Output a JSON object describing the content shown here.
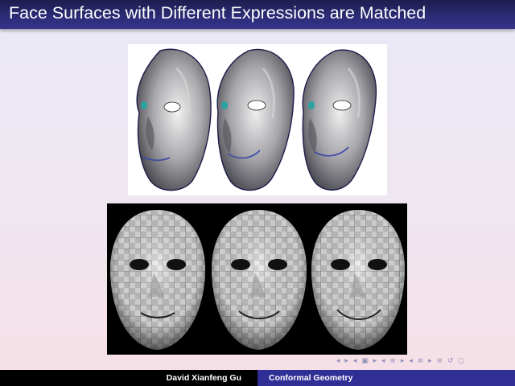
{
  "slide": {
    "title": "Face Surfaces with Different Expressions are Matched"
  },
  "figures": {
    "top_panel": {
      "faces": [
        "face-neutral",
        "face-smile",
        "face-smile-wide"
      ],
      "background": "#ffffff"
    },
    "bottom_panel": {
      "faces": [
        "face-mesh-1",
        "face-mesh-2",
        "face-mesh-3"
      ],
      "background": "#000000"
    }
  },
  "navigation": {
    "icons": [
      "nav-left-icon",
      "nav-right-icon",
      "frame-left-icon",
      "frame-right-icon",
      "section-left-icon",
      "section-right-icon",
      "subsection-left-icon",
      "subsection-right-icon",
      "toc-icon",
      "search-icon"
    ],
    "glyphs": [
      "◂",
      "▸",
      "◂",
      "▣",
      "▸",
      "◂",
      "≡",
      "▸",
      "◂",
      "≡",
      "▸",
      "≡",
      "↺",
      "○"
    ]
  },
  "footer": {
    "author": "David Xianfeng Gu",
    "talk_title": "Conformal Geometry"
  },
  "colors": {
    "title_bar": "#2c2c79",
    "footer_left": "#000000",
    "footer_right": "#2f2f96"
  }
}
